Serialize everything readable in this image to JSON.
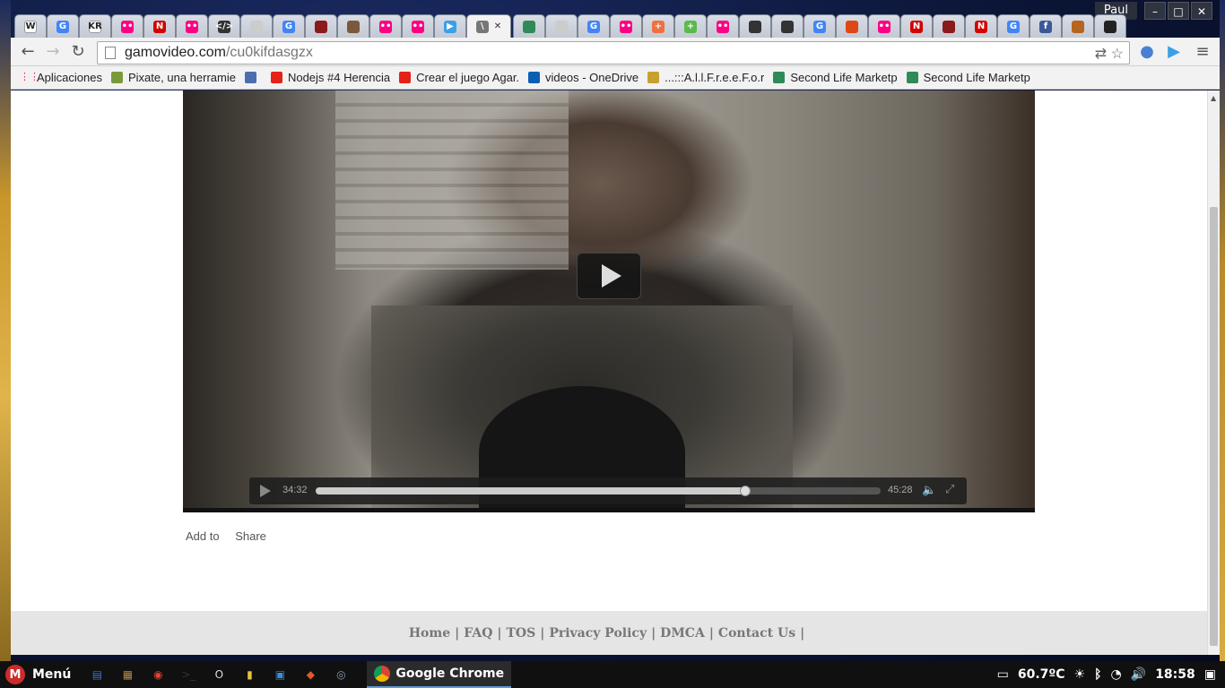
{
  "window": {
    "profile_name": "Paul",
    "controls": [
      "minimize",
      "maximize",
      "close"
    ]
  },
  "tabs": [
    {
      "icon": "wikipedia-icon",
      "label": "W",
      "color": "#ffffff"
    },
    {
      "icon": "google-icon",
      "label": "G",
      "color": "#4285f4"
    },
    {
      "icon": "kr-icon",
      "label": "KR",
      "color": "#ffffff"
    },
    {
      "icon": "flickr-icon",
      "label": "••",
      "color": "#ff0084"
    },
    {
      "icon": "red-n-icon",
      "label": "N",
      "color": "#d40000"
    },
    {
      "icon": "flickr-icon",
      "label": "••",
      "color": "#ff0084"
    },
    {
      "icon": "code-icon",
      "label": "</>",
      "color": "#333333"
    },
    {
      "icon": "page-icon",
      "label": "",
      "color": "#cccccc"
    },
    {
      "icon": "google-icon",
      "label": "G",
      "color": "#4285f4"
    },
    {
      "icon": "hat-icon",
      "label": "",
      "color": "#8b1a1a"
    },
    {
      "icon": "avatar-icon",
      "label": "",
      "color": "#7a5a3a"
    },
    {
      "icon": "flickr-icon",
      "label": "••",
      "color": "#ff0084"
    },
    {
      "icon": "flickr-icon",
      "label": "••",
      "color": "#ff0084"
    },
    {
      "icon": "play-circle-icon",
      "label": "▶",
      "color": "#3aa0e8"
    },
    {
      "icon": "gamovideo-active-icon",
      "label": "\\",
      "color": "#777777",
      "active": true
    },
    {
      "icon": "second-life-icon",
      "label": "",
      "color": "#2e8b57"
    },
    {
      "icon": "page-icon",
      "label": "",
      "color": "#cccccc"
    },
    {
      "icon": "google-icon",
      "label": "G",
      "color": "#4285f4"
    },
    {
      "icon": "flickr-icon",
      "label": "••",
      "color": "#ff0084"
    },
    {
      "icon": "plus-icon",
      "label": "+",
      "color": "#f07040"
    },
    {
      "icon": "compass-icon",
      "label": "+",
      "color": "#5aba4a"
    },
    {
      "icon": "flickr-icon",
      "label": "••",
      "color": "#ff0084"
    },
    {
      "icon": "mask-icon",
      "label": "",
      "color": "#333333"
    },
    {
      "icon": "mask-icon",
      "label": "",
      "color": "#333333"
    },
    {
      "icon": "google-icon",
      "label": "G",
      "color": "#4285f4"
    },
    {
      "icon": "ubuntu-icon",
      "label": "",
      "color": "#dd4814"
    },
    {
      "icon": "flickr-icon",
      "label": "••",
      "color": "#ff0084"
    },
    {
      "icon": "red-n-icon",
      "label": "N",
      "color": "#d40000"
    },
    {
      "icon": "hat-icon",
      "label": "",
      "color": "#8b1a1a"
    },
    {
      "icon": "red-n-icon",
      "label": "N",
      "color": "#d40000"
    },
    {
      "icon": "google-icon",
      "label": "G",
      "color": "#4285f4"
    },
    {
      "icon": "facebook-icon",
      "label": "f",
      "color": "#3b5998"
    },
    {
      "icon": "pile-icon",
      "label": "",
      "color": "#b5651d"
    },
    {
      "icon": "github-icon",
      "label": "",
      "color": "#222222"
    }
  ],
  "address_bar": {
    "host": "gamovideo.com",
    "path": "/cu0kifdasgzx"
  },
  "bookmarks": {
    "apps_label": "Aplicaciones",
    "items": [
      {
        "label": "Pixate, una herramie",
        "icon": "pixate-icon",
        "color": "#7a9a3a"
      },
      {
        "label": "",
        "icon": "image-icon",
        "color": "#4b6fae"
      },
      {
        "label": "Nodejs #4 Herencia",
        "icon": "youtube-icon",
        "color": "#e62117"
      },
      {
        "label": "Crear el juego Agar.",
        "icon": "youtube-icon",
        "color": "#e62117"
      },
      {
        "label": "videos - OneDrive",
        "icon": "onedrive-icon",
        "color": "#0a5fb4"
      },
      {
        "label": "...:::A.l.l.F.r.e.e.F.o.r",
        "icon": "figure-icon",
        "color": "#c8a030"
      },
      {
        "label": "Second Life Marketp",
        "icon": "second-life-icon",
        "color": "#2e8b57"
      },
      {
        "label": "Second Life Marketp",
        "icon": "second-life-icon",
        "color": "#2e8b57"
      }
    ]
  },
  "player": {
    "current_time": "34:32",
    "duration": "45:28",
    "progress_fraction": 0.7596
  },
  "page_actions": {
    "add_to": "Add to",
    "share": "Share"
  },
  "footer": {
    "links": [
      "Home",
      "FAQ",
      "TOS",
      "Privacy Policy",
      "DMCA",
      "Contact Us"
    ]
  },
  "taskbar": {
    "menu_label": "Menú",
    "launchers": [
      "files-icon",
      "archive-icon",
      "chrome-icon",
      "terminal-icon",
      "opera-icon",
      "folder-icon",
      "box-icon",
      "stack-icon",
      "webcam-icon"
    ],
    "active_task": "Google Chrome",
    "temperature": "60.7ºC",
    "clock": "18:58"
  }
}
